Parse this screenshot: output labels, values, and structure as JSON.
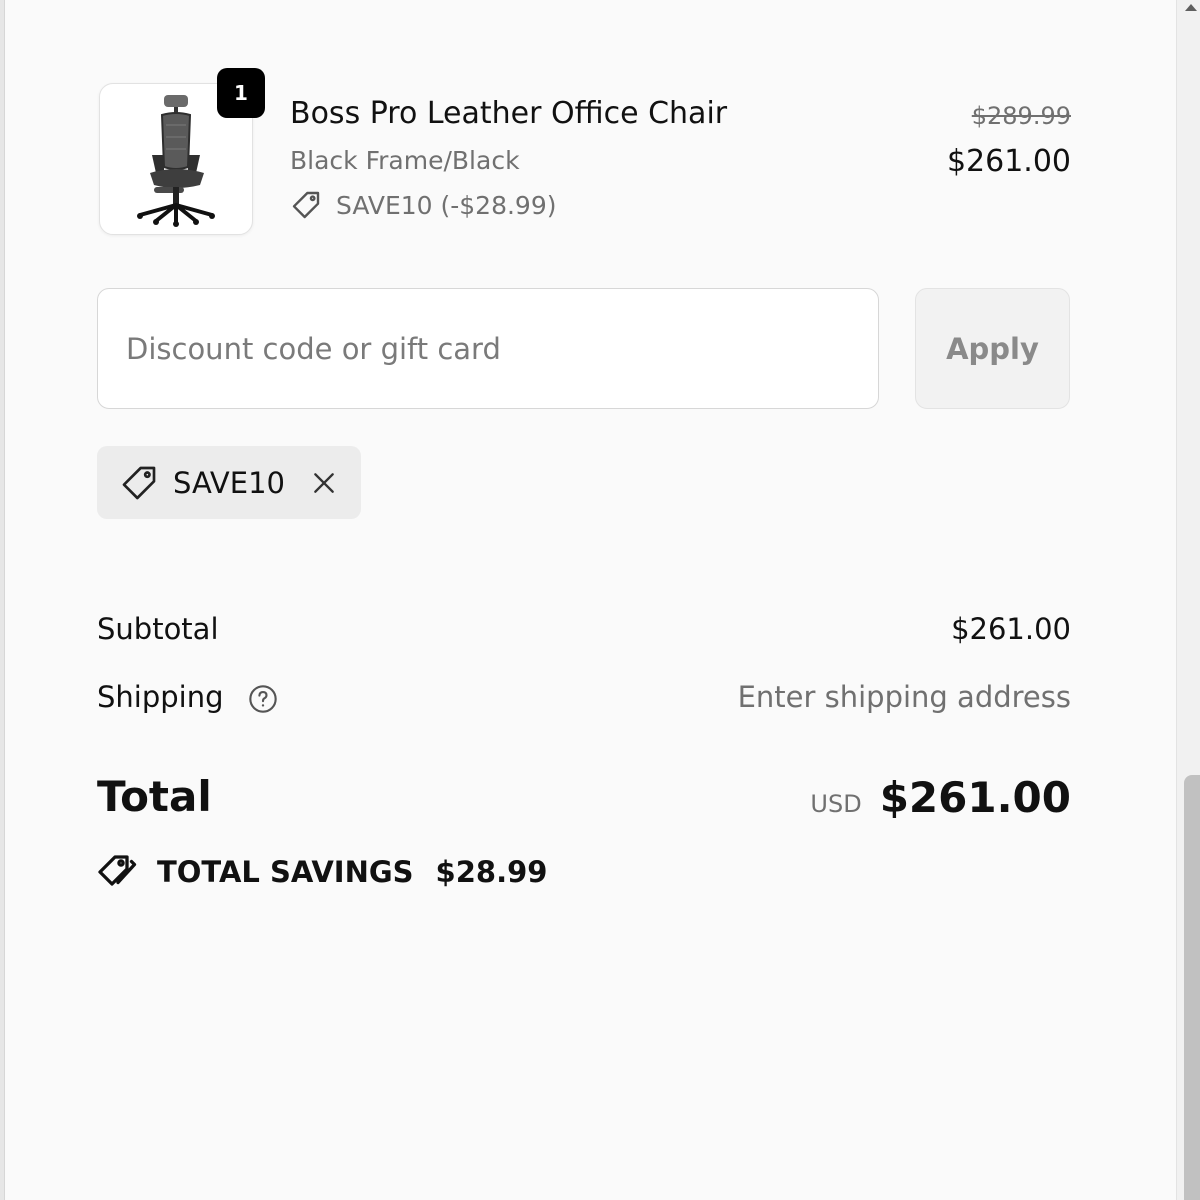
{
  "cart": {
    "item": {
      "quantity": "1",
      "name": "Boss Pro Leather Office Chair",
      "variant": "Black Frame/Black",
      "discount_line": "SAVE10 (-$28.99)",
      "price_original": "$289.99",
      "price_current": "$261.00",
      "image_icon": "office-chair-image"
    }
  },
  "discount": {
    "placeholder": "Discount code or gift card",
    "value": "",
    "apply_label": "Apply",
    "applied_code": "SAVE10"
  },
  "summary": {
    "subtotal_label": "Subtotal",
    "subtotal_value": "$261.00",
    "shipping_label": "Shipping",
    "shipping_value": "Enter shipping address",
    "total_label": "Total",
    "total_currency": "USD",
    "total_value": "$261.00",
    "savings_label": "TOTAL SAVINGS",
    "savings_value": "$28.99"
  },
  "colors": {
    "background": "#fafafa",
    "badge": "#000000",
    "muted_text": "#707070"
  }
}
